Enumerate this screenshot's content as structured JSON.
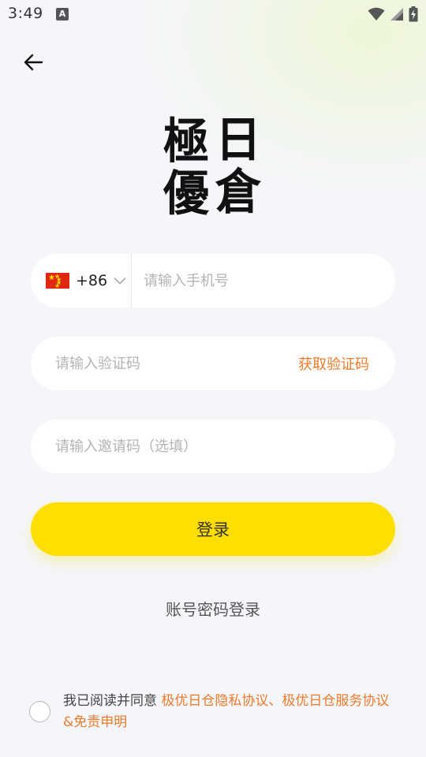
{
  "status_bar": {
    "time": "3:49",
    "notification_icon": "A"
  },
  "logo": {
    "chars": [
      "極",
      "日",
      "優",
      "倉"
    ]
  },
  "phone": {
    "country_code": "+86",
    "placeholder": "请输入手机号"
  },
  "verify": {
    "placeholder": "请输入验证码",
    "get_code_label": "获取验证码"
  },
  "invite": {
    "placeholder": "请输入邀请码（选填）"
  },
  "login_label": "登录",
  "password_login_label": "账号密码登录",
  "agreement": {
    "prefix": "我已阅读并同意 ",
    "privacy_link": "极优日仓隐私协议",
    "separator": "、",
    "service_link": "极优日仓服务协议&免责申明"
  },
  "colors": {
    "accent": "#ffde00",
    "link": "#ef7a2b"
  }
}
